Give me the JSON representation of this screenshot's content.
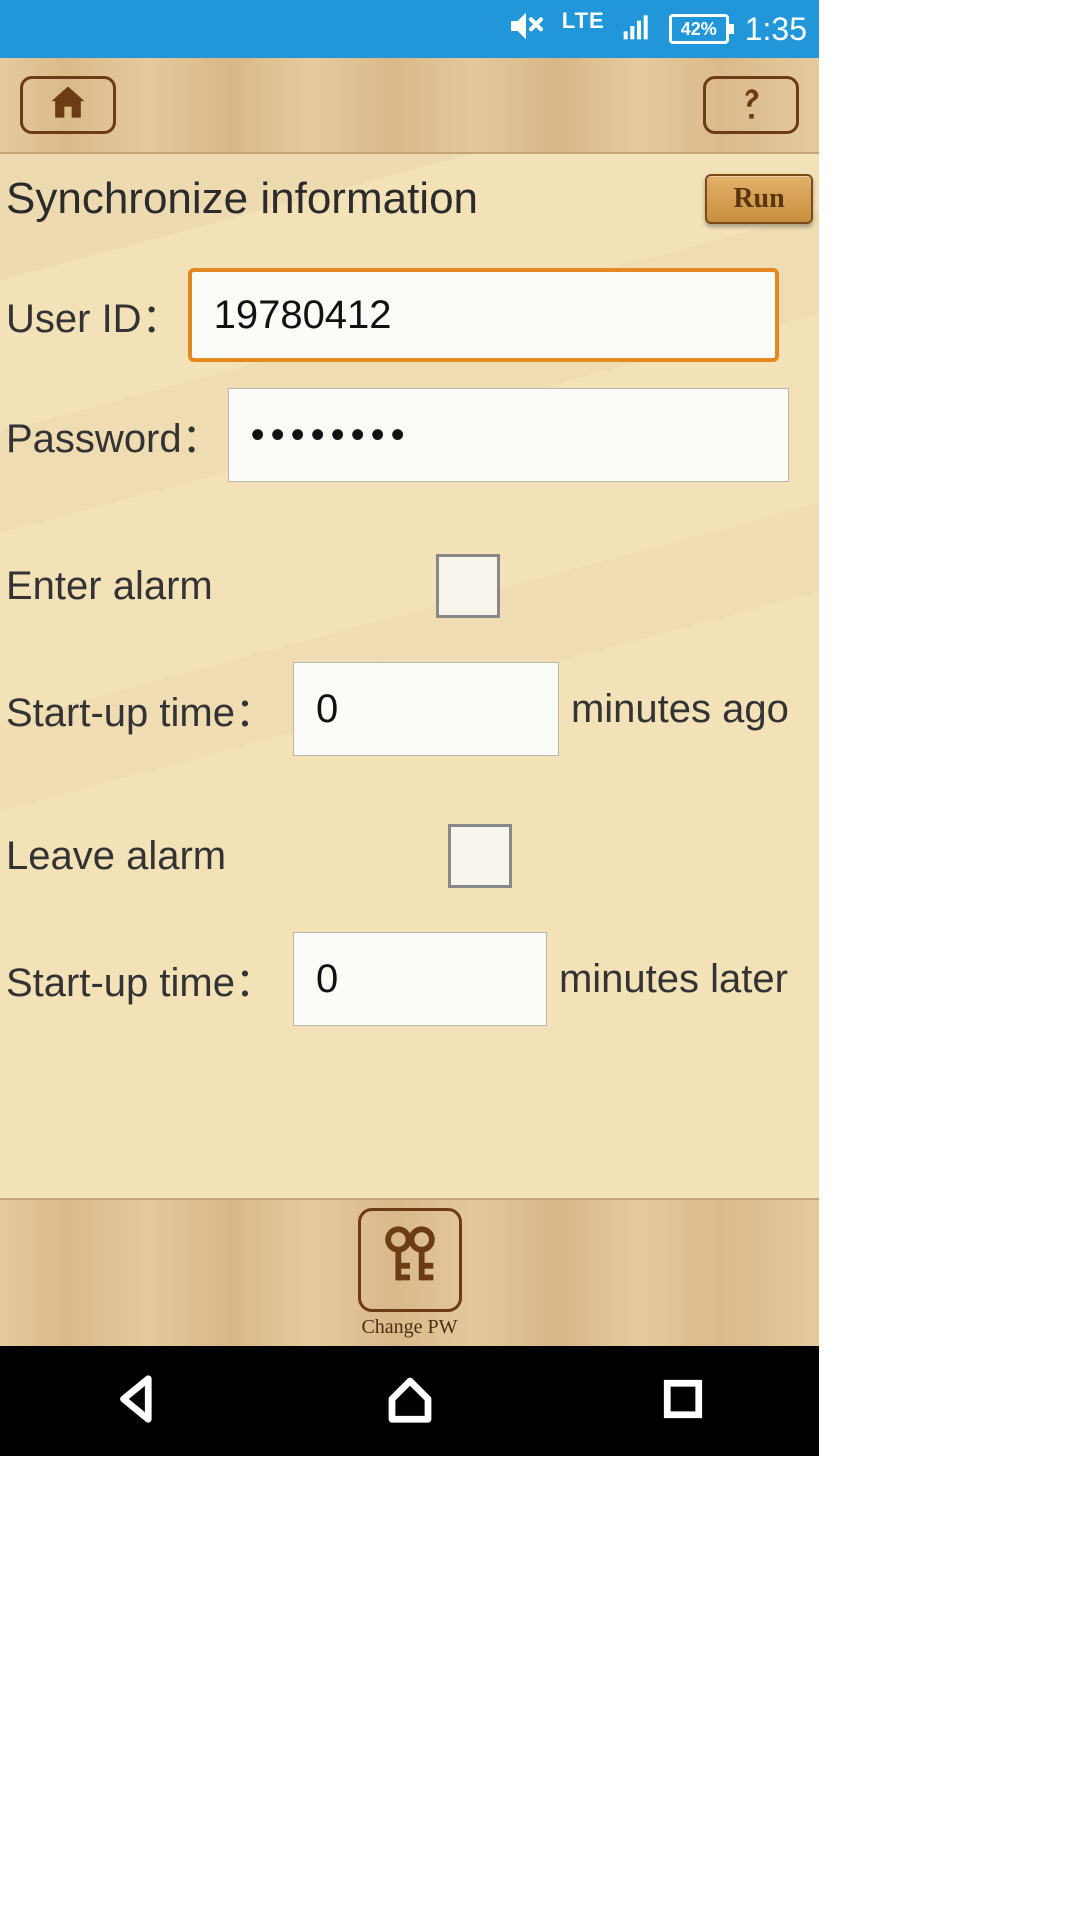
{
  "status": {
    "network_type": "LTE",
    "battery": "42%",
    "clock": "1:35"
  },
  "page": {
    "title": "Synchronize information",
    "run_label": "Run"
  },
  "form": {
    "user_id_label": "User ID：",
    "user_id_value": "19780412",
    "password_label": "Password：",
    "password_value": "••••••••",
    "enter_alarm_label": "Enter alarm",
    "startup1_label": "Start-up time：",
    "startup1_value": "0",
    "startup1_suffix": "minutes ago",
    "leave_alarm_label": "Leave alarm",
    "startup2_label": "Start-up time：",
    "startup2_value": "0",
    "startup2_suffix": "minutes later"
  },
  "footer": {
    "change_pw_label": "Change PW"
  }
}
